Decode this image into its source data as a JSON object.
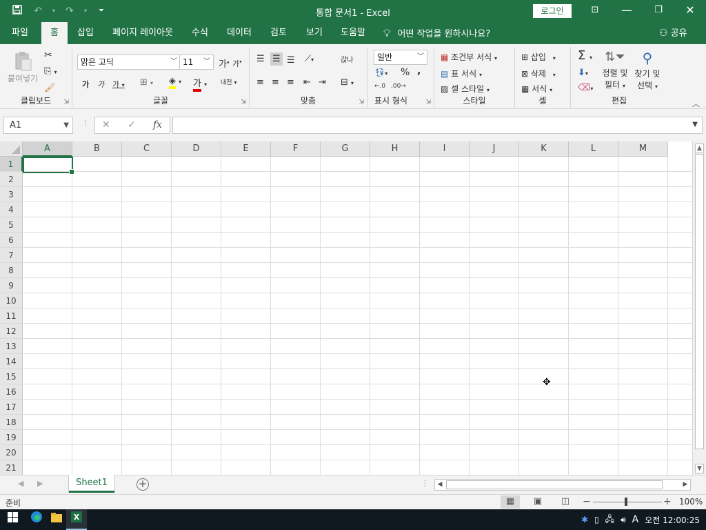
{
  "titlebar": {
    "title": "통합 문서1  -  Excel",
    "login_label": "로그인",
    "save_icon": "save-icon",
    "undo_icon": "undo-icon",
    "redo_icon": "redo-icon",
    "customize_icon": "customize-qat-icon"
  },
  "tabs": [
    {
      "label": "파일"
    },
    {
      "label": "홈"
    },
    {
      "label": "삽입"
    },
    {
      "label": "페이지 레이아웃"
    },
    {
      "label": "수식"
    },
    {
      "label": "데이터"
    },
    {
      "label": "검토"
    },
    {
      "label": "보기"
    },
    {
      "label": "도움말"
    }
  ],
  "active_tab": "홈",
  "tell_me": "어떤 작업을 원하시나요?",
  "share_label": "공유",
  "ribbon": {
    "clipboard": {
      "label": "클립보드",
      "paste_label": "붙여넣기"
    },
    "font": {
      "label": "글꼴",
      "font_name": "맑은 고딕",
      "font_size": "11",
      "bold": "가",
      "italic": "가",
      "underline": "가",
      "grow": "가",
      "shrink": "가",
      "phonetic": "내천",
      "font_color_glyph": "가"
    },
    "alignment": {
      "label": "맞춤",
      "wrap": "갅나"
    },
    "number": {
      "label": "표시 형식",
      "format": "일반"
    },
    "styles": {
      "label": "스타일",
      "conditional": "조건부 서식",
      "table": "표 서식",
      "cell": "셀 스타일"
    },
    "cells": {
      "label": "셀",
      "insert": "삽입",
      "delete": "삭제",
      "format": "서식"
    },
    "editing": {
      "label": "편집",
      "sort_l1": "정렬 및",
      "sort_l2": "필터",
      "find_l1": "찾기 및",
      "find_l2": "선택"
    }
  },
  "formula_bar": {
    "name_box": "A1",
    "cancel": "✕",
    "enter": "✓",
    "fx": "fx",
    "content": ""
  },
  "columns": [
    "A",
    "B",
    "C",
    "D",
    "E",
    "F",
    "G",
    "H",
    "I",
    "J",
    "K",
    "L",
    "M"
  ],
  "rows": [
    "1",
    "2",
    "3",
    "4",
    "5",
    "6",
    "7",
    "8",
    "9",
    "10",
    "11",
    "12",
    "13",
    "14",
    "15",
    "16",
    "17",
    "18",
    "19",
    "20",
    "21"
  ],
  "selected_cell": "A1",
  "sheets": [
    {
      "name": "Sheet1",
      "active": true
    }
  ],
  "status": {
    "ready": "준비",
    "zoom": "100%",
    "zoom_fraction": 0.5,
    "active_view": "normal"
  },
  "taskbar": {
    "apps": [
      "windows-start-icon",
      "edge-icon",
      "file-explorer-icon",
      "excel-icon"
    ],
    "tray_ime": "A",
    "clock": "오전 12:00:25"
  },
  "colors": {
    "accent": "#217346",
    "taskbar": "#101820"
  }
}
